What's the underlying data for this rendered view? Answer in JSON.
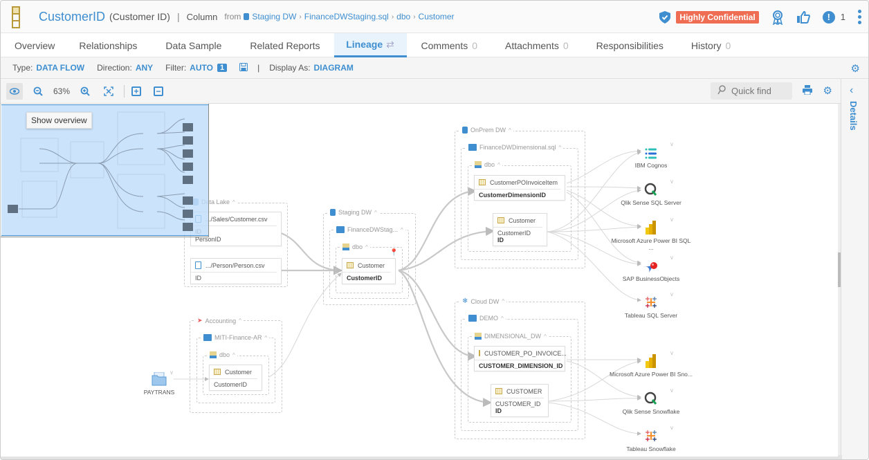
{
  "header": {
    "title": "CustomerID",
    "subtitle": "(Customer ID)",
    "separator": "|",
    "kind": "Column",
    "from_label": "from",
    "breadcrumb": [
      "Staging DW",
      "FinanceDWStaging.sql",
      "dbo",
      "Customer"
    ],
    "classification": "Highly Confidential",
    "issues_count": "1",
    "colors": {
      "accent": "#3e8ed0",
      "classification_bg": "#ee6d53"
    }
  },
  "tabs": [
    {
      "label": "Overview",
      "count": ""
    },
    {
      "label": "Relationships",
      "count": ""
    },
    {
      "label": "Data Sample",
      "count": ""
    },
    {
      "label": "Related Reports",
      "count": ""
    },
    {
      "label": "Lineage",
      "count": "",
      "active": true,
      "icon": "⇄"
    },
    {
      "label": "Comments",
      "count": "0"
    },
    {
      "label": "Attachments",
      "count": "0"
    },
    {
      "label": "Responsibilities",
      "count": ""
    },
    {
      "label": "History",
      "count": "0"
    }
  ],
  "filterbar": {
    "type_label": "Type:",
    "type_value": "DATA FLOW",
    "direction_label": "Direction:",
    "direction_value": "ANY",
    "filter_label": "Filter:",
    "filter_value": "AUTO",
    "filter_count": "1",
    "display_label": "Display As:",
    "display_value": "DIAGRAM"
  },
  "toolbar": {
    "zoom_level": "63%",
    "quickfind_placeholder": "Quick find"
  },
  "details_rail": {
    "label": "Details"
  },
  "overview": {
    "tooltip": "Show overview"
  },
  "diagram": {
    "data_lake": {
      "label": "Data Lake",
      "files": [
        {
          "name": ".../Sales/Customer.csv",
          "columns": [
            "ID",
            "PersonID"
          ]
        },
        {
          "name": ".../Person/Person.csv",
          "columns": [
            "ID"
          ]
        }
      ]
    },
    "staging": {
      "label": "Staging DW",
      "folder": "FinanceDWStag...",
      "schema": "dbo",
      "table": "Customer",
      "column": "CustomerID"
    },
    "accounting": {
      "label": "Accounting",
      "folder": "MITI-Finance-AR",
      "schema": "dbo",
      "table": "Customer",
      "column": "CustomerID",
      "source": "PAYTRANS"
    },
    "onprem": {
      "label": "OnPrem DW",
      "folder": "FinanceDWDimensional.sql",
      "schema": "dbo",
      "tables": [
        {
          "name": "CustomerPOInvoiceItem",
          "columns": [
            "CustomerDimensionID"
          ]
        },
        {
          "name": "Customer",
          "columns": [
            "CustomerID",
            "ID"
          ]
        }
      ]
    },
    "cloud": {
      "label": "Cloud DW",
      "folder": "DEMO",
      "schema": "DIMENSIONAL_DW",
      "tables": [
        {
          "name": "CUSTOMER_PO_INVOICE...",
          "columns": [
            "CUSTOMER_DIMENSION_ID"
          ]
        },
        {
          "name": "CUSTOMER",
          "columns": [
            "CUSTOMER_ID",
            "ID"
          ]
        }
      ]
    },
    "targets": [
      {
        "label": "IBM Cognos",
        "icon": "cognos-icon"
      },
      {
        "label": "Qlik Sense SQL Server",
        "icon": "qlik-icon"
      },
      {
        "label": "Microsoft Azure Power BI SQL ...",
        "icon": "powerbi-icon"
      },
      {
        "label": "SAP BusinessObjects",
        "icon": "sap-icon"
      },
      {
        "label": "Tableau SQL Server",
        "icon": "tableau-icon"
      },
      {
        "label": "Microsoft Azure Power BI Sno...",
        "icon": "powerbi-icon"
      },
      {
        "label": "Qlik Sense Snowflake",
        "icon": "qlik-icon"
      },
      {
        "label": "Tableau Snowflake",
        "icon": "tableau-icon"
      }
    ]
  }
}
